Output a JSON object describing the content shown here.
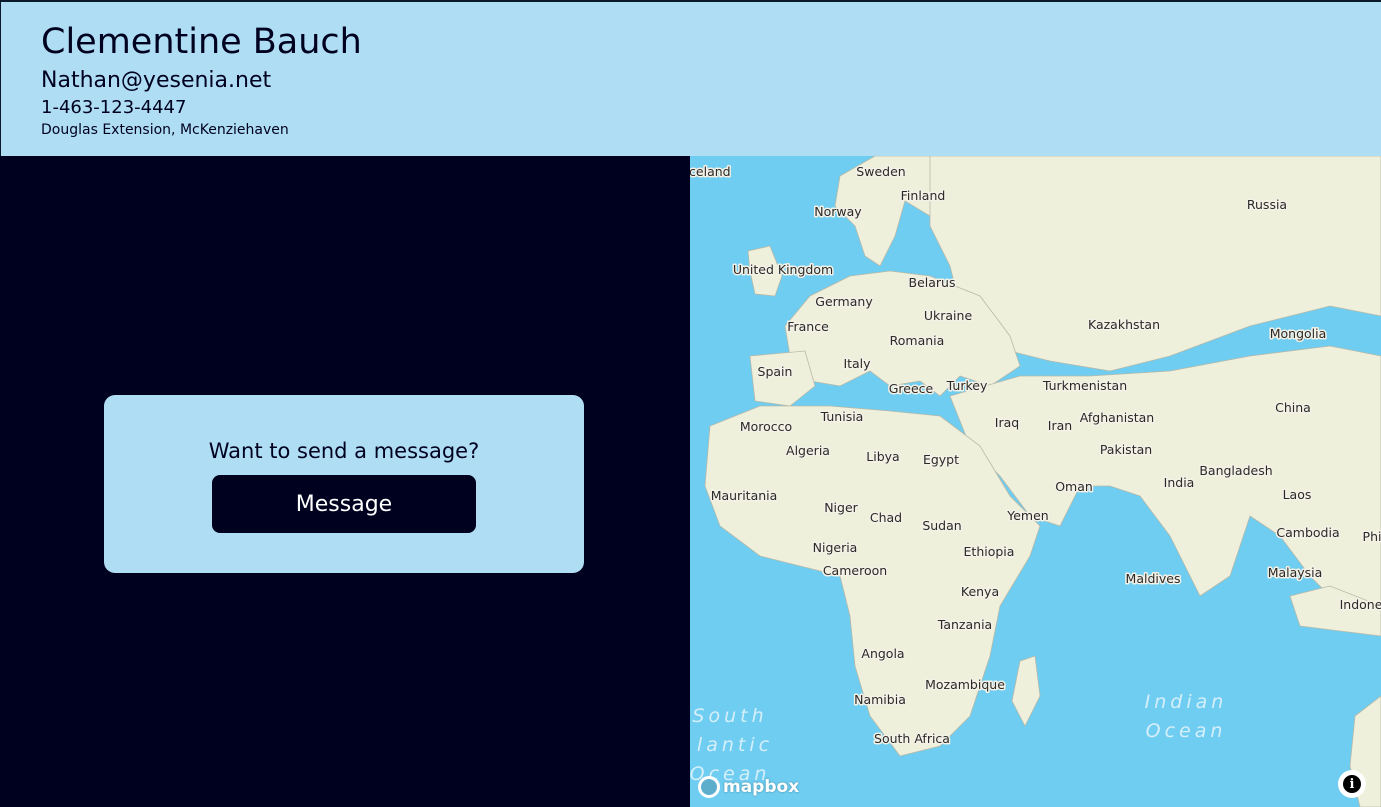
{
  "profile": {
    "name": "Clementine Bauch",
    "email": "Nathan@yesenia.net",
    "phone": "1-463-123-4447",
    "address": "Douglas Extension, McKenziehaven"
  },
  "contact_card": {
    "prompt": "Want to send a message?",
    "button_label": "Message"
  },
  "map": {
    "countries": [
      "Iceland",
      "Sweden",
      "Finland",
      "Norway",
      "Russia",
      "United Kingdom",
      "Belarus",
      "Germany",
      "Ukraine",
      "France",
      "Kazakhstan",
      "Mongolia",
      "Romania",
      "Italy",
      "Spain",
      "Greece",
      "Turkey",
      "Turkmenistan",
      "China",
      "Tunisia",
      "Morocco",
      "Iraq",
      "Iran",
      "Afghanistan",
      "Algeria",
      "Libya",
      "Egypt",
      "Pakistan",
      "Bangladesh",
      "India",
      "Oman",
      "Laos",
      "Mauritania",
      "Niger",
      "Chad",
      "Sudan",
      "Yemen",
      "Cambodia",
      "Phi",
      "Nigeria",
      "Ethiopia",
      "Cameroon",
      "Maldives",
      "Malaysia",
      "Indone",
      "Kenya",
      "Tanzania",
      "Angola",
      "Mozambique",
      "Namibia",
      "South Africa"
    ],
    "oceans": [
      "South",
      "lantic",
      "Ocean",
      "Indian",
      "Ocean"
    ],
    "attribution_logo": "mapbox",
    "info_icon": "info-icon",
    "colors": {
      "water": "#6ecdf0",
      "land": "#eef0dc"
    }
  },
  "colors": {
    "header_bg": "#afdef4",
    "page_bg": "#00011f",
    "button_bg": "#00011f",
    "button_text": "#ffffff"
  }
}
